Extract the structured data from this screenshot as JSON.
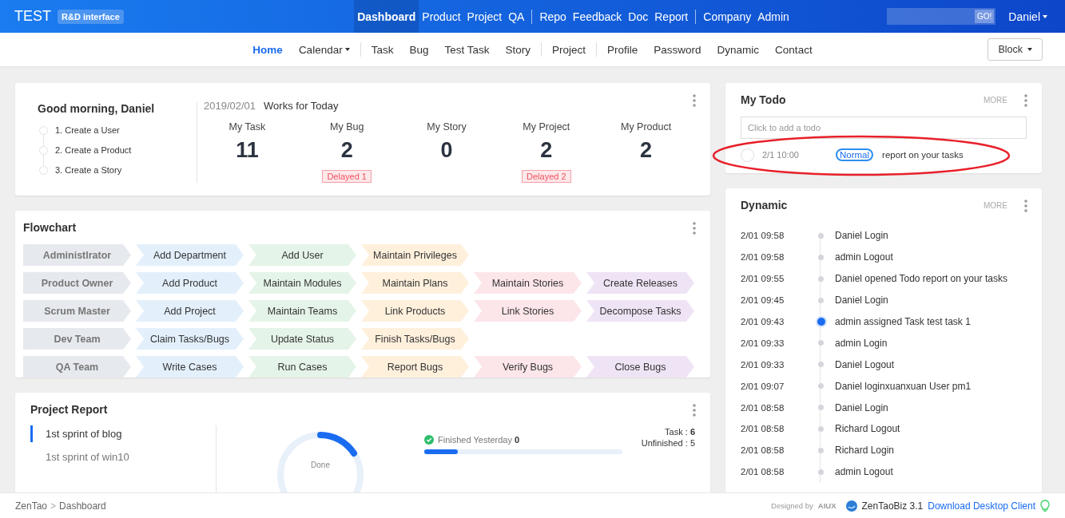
{
  "header": {
    "brand": "TEST",
    "badge": "R&D interface",
    "nav_groups": [
      [
        {
          "label": "Dashboard",
          "selected": true
        },
        {
          "label": "Product",
          "selected": false
        },
        {
          "label": "Project",
          "selected": false
        },
        {
          "label": "QA",
          "selected": false
        }
      ],
      [
        {
          "label": "Repo",
          "selected": false
        },
        {
          "label": "Feedback",
          "selected": false
        },
        {
          "label": "Doc",
          "selected": false
        },
        {
          "label": "Report",
          "selected": false
        }
      ],
      [
        {
          "label": "Company",
          "selected": false
        },
        {
          "label": "Admin",
          "selected": false
        }
      ]
    ],
    "search_button": "GO!",
    "user": "Daniel"
  },
  "subnav": {
    "groups": [
      [
        {
          "label": "Home",
          "selected": true,
          "dropdown": false
        },
        {
          "label": "Calendar",
          "selected": false,
          "dropdown": true
        }
      ],
      [
        {
          "label": "Task",
          "selected": false,
          "dropdown": false
        },
        {
          "label": "Bug",
          "selected": false,
          "dropdown": false
        },
        {
          "label": "Test Task",
          "selected": false,
          "dropdown": false
        },
        {
          "label": "Story",
          "selected": false,
          "dropdown": false
        }
      ],
      [
        {
          "label": "Project",
          "selected": false,
          "dropdown": false
        }
      ],
      [
        {
          "label": "Profile",
          "selected": false,
          "dropdown": false
        },
        {
          "label": "Password",
          "selected": false,
          "dropdown": false
        },
        {
          "label": "Dynamic",
          "selected": false,
          "dropdown": false
        },
        {
          "label": "Contact",
          "selected": false,
          "dropdown": false
        }
      ]
    ],
    "block_button": "Block"
  },
  "welcome": {
    "greeting": "Good morning, Daniel",
    "steps": [
      "1. Create a User",
      "2. Create a Product",
      "3. Create a Story"
    ],
    "date": "2019/02/01",
    "subtitle": "Works for Today",
    "stats": [
      {
        "label": "My Task",
        "value": "11"
      },
      {
        "label": "My Bug",
        "value": "2",
        "delayed": "Delayed 1"
      },
      {
        "label": "My Story",
        "value": "0"
      },
      {
        "label": "My Project",
        "value": "2",
        "delayed": "Delayed 2"
      },
      {
        "label": "My Product",
        "value": "2"
      }
    ]
  },
  "flowchart": {
    "title": "Flowchart",
    "rows": [
      {
        "role": "Administlrator",
        "steps": [
          "Add Department",
          "Add User",
          "Maintain Privileges"
        ]
      },
      {
        "role": "Product Owner",
        "steps": [
          "Add Product",
          "Maintain Modules",
          "Maintain Plans",
          "Maintain Stories",
          "Create Releases"
        ]
      },
      {
        "role": "Scrum Master",
        "steps": [
          "Add Project",
          "Maintain Teams",
          "Link Products",
          "Link Stories",
          "Decompose Tasks"
        ]
      },
      {
        "role": "Dev Team",
        "steps": [
          "Claim Tasks/Bugs",
          "Update Status",
          "Finish Tasks/Bugs"
        ]
      },
      {
        "role": "QA Team",
        "steps": [
          "Write Cases",
          "Run Cases",
          "Report Bugs",
          "Verify Bugs",
          "Close Bugs"
        ]
      }
    ]
  },
  "project_report": {
    "title": "Project Report",
    "projects": [
      {
        "name": "1st sprint of blog",
        "selected": true
      },
      {
        "name": "1st sprint of win10",
        "selected": false
      }
    ],
    "donut_label": "Done",
    "finished_label": "Finished Yesterday",
    "finished_value": "0",
    "progress": {
      "level": 0.17
    },
    "task_label": "Task : ",
    "task_value": "6",
    "unfinished": "Unfinished : 5"
  },
  "todo": {
    "title": "My Todo",
    "more": "MORE",
    "placeholder": "Click to add a todo",
    "items": [
      {
        "checked": false,
        "time": "2/1 10:00",
        "priority": "Normal",
        "text": "report on your tasks"
      }
    ]
  },
  "dynamic": {
    "title": "Dynamic",
    "more": "MORE",
    "items": [
      {
        "time": "2/01 09:58",
        "text": "Daniel Login",
        "highlighted": false
      },
      {
        "time": "2/01 09:58",
        "text": "admin Logout",
        "highlighted": false
      },
      {
        "time": "2/01 09:55",
        "text": "Daniel opened Todo report on your tasks",
        "highlighted": false
      },
      {
        "time": "2/01 09:45",
        "text": "Daniel Login",
        "highlighted": false
      },
      {
        "time": "2/01 09:43",
        "text": "admin assigned Task test task 1",
        "highlighted": true
      },
      {
        "time": "2/01 09:33",
        "text": "admin Login",
        "highlighted": false
      },
      {
        "time": "2/01 09:33",
        "text": "Daniel Logout",
        "highlighted": false
      },
      {
        "time": "2/01 09:07",
        "text": "Daniel loginxuanxuan User pm1",
        "highlighted": false
      },
      {
        "time": "2/01 08:58",
        "text": "Daniel Login",
        "highlighted": false
      },
      {
        "time": "2/01 08:58",
        "text": "Richard Logout",
        "highlighted": false
      },
      {
        "time": "2/01 08:58",
        "text": "Richard Login",
        "highlighted": false
      },
      {
        "time": "2/01 08:58",
        "text": "admin Logout",
        "highlighted": false
      }
    ]
  },
  "footer": {
    "breadcrumb": [
      "ZenTao",
      "Dashboard"
    ],
    "separator": ">",
    "designed_by": "Designed by",
    "designer": "AIUX",
    "version": "ZenTaoBiz 3.1",
    "download": "Download Desktop Client"
  }
}
